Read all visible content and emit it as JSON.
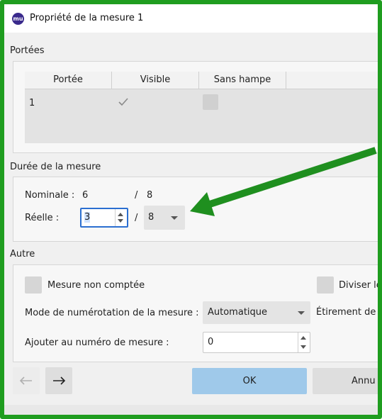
{
  "window": {
    "title": "Propriété de la mesure 1",
    "app_icon": "mu"
  },
  "portees": {
    "section_label": "Portées",
    "columns": [
      "Portée",
      "Visible",
      "Sans hampe"
    ],
    "rows": [
      {
        "portee": "1",
        "visible": true,
        "sans_hampe": false
      }
    ]
  },
  "duree": {
    "section_label": "Durée de la mesure",
    "nominale_label": "Nominale :",
    "nominale_num": "6",
    "nominale_sep": "/",
    "nominale_den": "8",
    "reelle_label": "Réelle :",
    "reelle_num": "3",
    "reelle_sep": "/",
    "reelle_den": "8"
  },
  "autre": {
    "section_label": "Autre",
    "mesure_non_comptee": "Mesure non comptée",
    "diviser_label": "Diviser le",
    "mode_label": "Mode de numérotation de la mesure :",
    "mode_value": "Automatique",
    "etirement_label": "Étirement de l",
    "ajouter_label": "Ajouter au numéro de mesure :",
    "ajouter_value": "0"
  },
  "footer": {
    "ok_label": "OK",
    "cancel_label": "Annu"
  },
  "colors": {
    "annotation_arrow": "#1f8f1f",
    "ok_button": "#9fc9ea"
  }
}
